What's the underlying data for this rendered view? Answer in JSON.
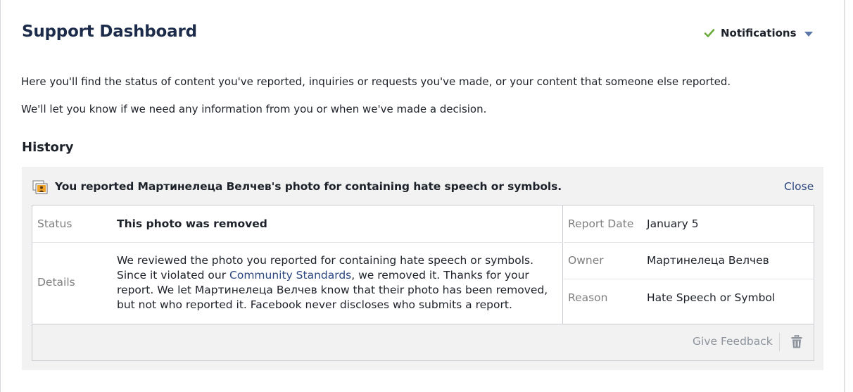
{
  "page": {
    "title": "Support Dashboard",
    "notifications_label": "Notifications",
    "intro_line1": "Here you'll find the status of content you've reported, inquiries or requests you've made, or your content that someone else reported.",
    "intro_line2": "We'll let you know if we need any information from you or when we've made a decision.",
    "history_heading": "History"
  },
  "icons": {
    "notifications_check": "checkmark-icon",
    "notifications_dropdown": "caret-down-icon",
    "report_type": "photo-report-icon",
    "delete": "trash-icon"
  },
  "colors": {
    "link": "#2c4680",
    "check_green": "#6bab3b",
    "caret_blue": "#5b75a8",
    "muted_label": "#7f7f7f"
  },
  "report": {
    "title": "You reported Мартинелеца Велчев's photo for containing hate speech or symbols.",
    "close_label": "Close",
    "status_label": "Status",
    "status_value": "This photo was removed",
    "details_label": "Details",
    "details_part1": "We reviewed the photo you reported for containing hate speech or symbols. Since it violated our ",
    "details_link": "Community Standards",
    "details_part2": ", we removed it. Thanks for your report. We let Мартинелеца Велчев know that their photo has been removed, but not who reported it. Facebook never discloses who submits a report.",
    "report_date_label": "Report Date",
    "report_date_value": "January 5",
    "owner_label": "Owner",
    "owner_value": "Мартинелеца Велчев",
    "reason_label": "Reason",
    "reason_value": "Hate Speech or Symbol",
    "give_feedback_label": "Give Feedback"
  }
}
